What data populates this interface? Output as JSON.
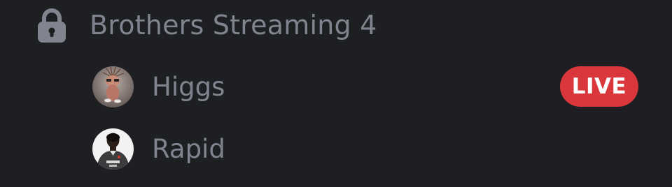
{
  "channel": {
    "name": "Brothers Streaming 4",
    "icon": "lock-icon"
  },
  "users": [
    {
      "name": "Higgs",
      "avatar": "avatar-higgs",
      "badge": "LIVE"
    },
    {
      "name": "Rapid",
      "avatar": "avatar-rapid"
    }
  ],
  "colors": {
    "background": "#1e1f22",
    "muted_text": "#80848e",
    "live_badge": "#da373c"
  }
}
